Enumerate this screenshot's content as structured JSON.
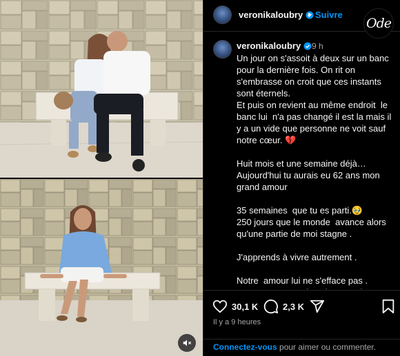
{
  "header": {
    "username": "veronikaloubry",
    "separator": "•",
    "follow_label": "Suivre",
    "logo_text": "Ode"
  },
  "post": {
    "username": "veronikaloubry",
    "time": "9 h",
    "caption": "Un jour on s'assoit à deux sur un banc pour la dernière fois. On rit on s'embrasse on croit que ces instants sont éternels.\nEt puis on revient au même endroit  le banc lui  n'a pas changé il est la mais il y a un vide que personne ne voit sauf notre cœur. 💔\n\nHuit mois et une semaine déjà…\nAujourd'hui tu aurais eu 62 ans mon grand amour\n\n35 semaines  que tu es parti.🥹\n250 jours que le monde  avance alors qu'une partie de moi stagne .\n\nJ'apprends à vivre autrement .\n\nNotre  amour lui ne s'efface pas .\nTu me manques dans les grandes choses bien sûr…"
  },
  "actions": {
    "likes": "30,1 K",
    "comments": "2,3 K",
    "time_ago": "Il y a 9 heures"
  },
  "login": {
    "link": "Connectez-vous",
    "text": " pour aimer ou commenter."
  },
  "colors": {
    "accent": "#0095f6",
    "background": "#000000",
    "muted": "#a8a8a8"
  },
  "icons": [
    "verified-badge-icon",
    "heart-icon",
    "comment-icon",
    "share-icon",
    "bookmark-icon",
    "speaker-muted-icon"
  ]
}
